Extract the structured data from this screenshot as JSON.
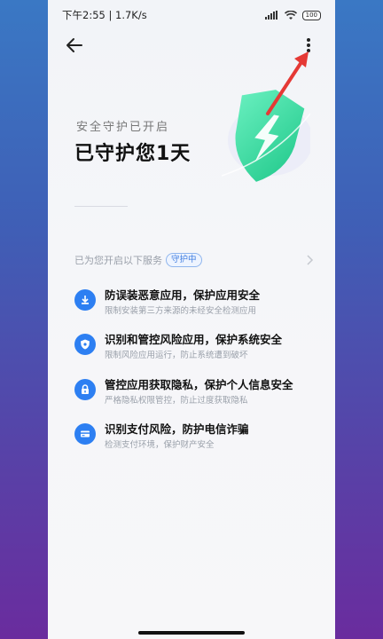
{
  "status_bar": {
    "time_speed": "下午2:55 | 1.7K/s",
    "battery": "100"
  },
  "header": {
    "back_icon": "back-arrow-icon",
    "more_icon": "more-vertical-icon"
  },
  "hero": {
    "subtitle": "安全守护已开启",
    "headline": "已守护您1天",
    "shield_icon": "shield-lightning-icon"
  },
  "services": {
    "label": "已为您开启以下服务",
    "badge": "守护中",
    "items": [
      {
        "icon": "download-icon",
        "title": "防误装恶意应用，保护应用安全",
        "desc": "限制安装第三方来源的未经安全检测应用"
      },
      {
        "icon": "shield-small-icon",
        "title": "识别和管控风险应用，保护系统安全",
        "desc": "限制风险应用运行，防止系统遭到破坏"
      },
      {
        "icon": "lock-icon",
        "title": "管控应用获取隐私，保护个人信息安全",
        "desc": "严格隐私权限管控，防止过度获取隐私"
      },
      {
        "icon": "card-icon",
        "title": "识别支付风险，防护电信诈骗",
        "desc": "检测支付环境，保护财产安全"
      }
    ]
  },
  "colors": {
    "accent": "#2d7ff2",
    "shield": "#3ee0a0",
    "arrow": "#e53935"
  }
}
